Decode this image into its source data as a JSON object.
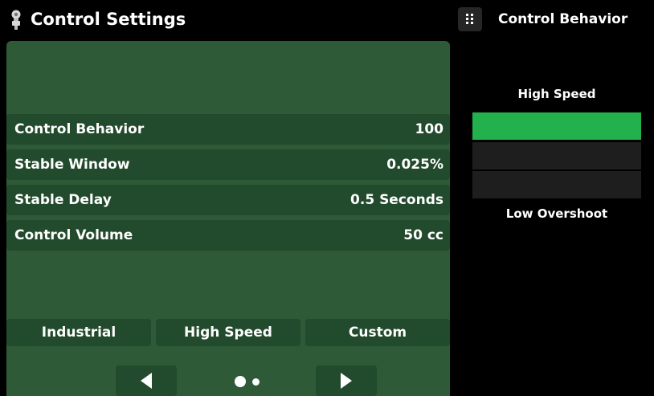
{
  "header": {
    "title": "Control Settings",
    "icon": "regulator-icon"
  },
  "settings": [
    {
      "label": "Control Behavior",
      "value": "100"
    },
    {
      "label": "Stable Window",
      "value": "0.025%"
    },
    {
      "label": "Stable Delay",
      "value": "0.5 Seconds"
    },
    {
      "label": "Control Volume",
      "value": "50 cc"
    }
  ],
  "presets": [
    "Industrial",
    "High Speed",
    "Custom"
  ],
  "pager": {
    "current_page": 1,
    "total_pages": 2
  },
  "side_panel": {
    "title": "Control Behavior",
    "menu_icon": "grid-dots-icon",
    "top_label": "High Speed",
    "bottom_label": "Low Overshoot",
    "selected_level": 1,
    "level_count": 3
  },
  "colors": {
    "background": "#000000",
    "panel": "#2f5a38",
    "row": "#224a2c",
    "selected_bar": "#22b14c",
    "unselected_bar": "#1e1e1e"
  }
}
